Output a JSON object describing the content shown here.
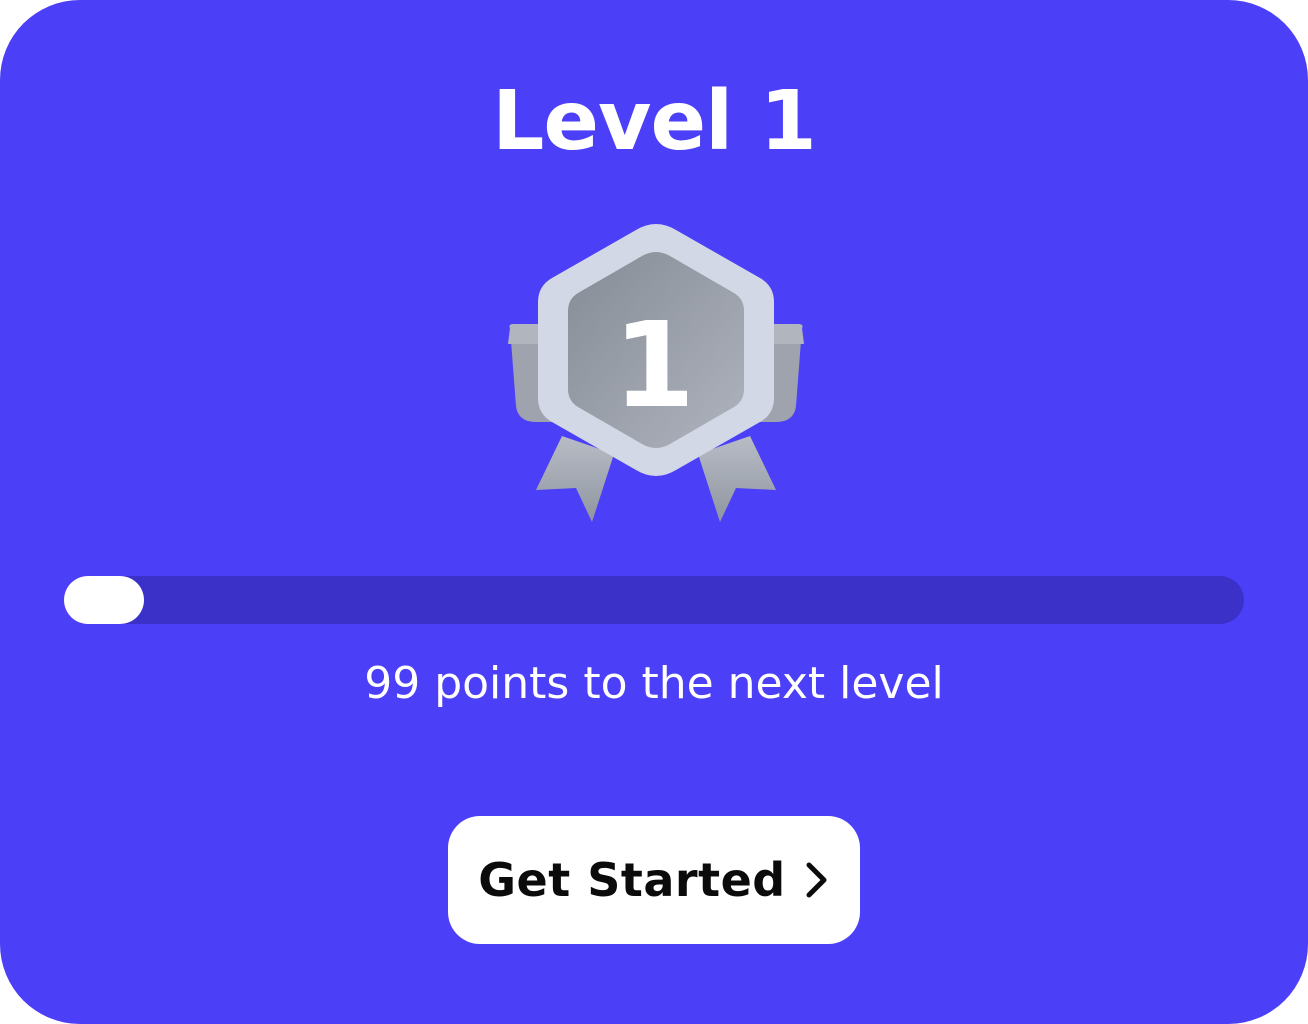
{
  "card": {
    "title": "Level 1",
    "badge": {
      "icon": "level-medal-icon",
      "number": "1"
    },
    "progress": {
      "fraction": 0.01
    },
    "caption": "99 points to the next level",
    "cta": {
      "label": "Get Started",
      "icon": "chevron-right-icon"
    }
  },
  "colors": {
    "background": "#4b3ff7",
    "track": "#3b31c9",
    "fill": "#ffffff",
    "button": "#ffffff",
    "button_text": "#0b0b0b"
  }
}
